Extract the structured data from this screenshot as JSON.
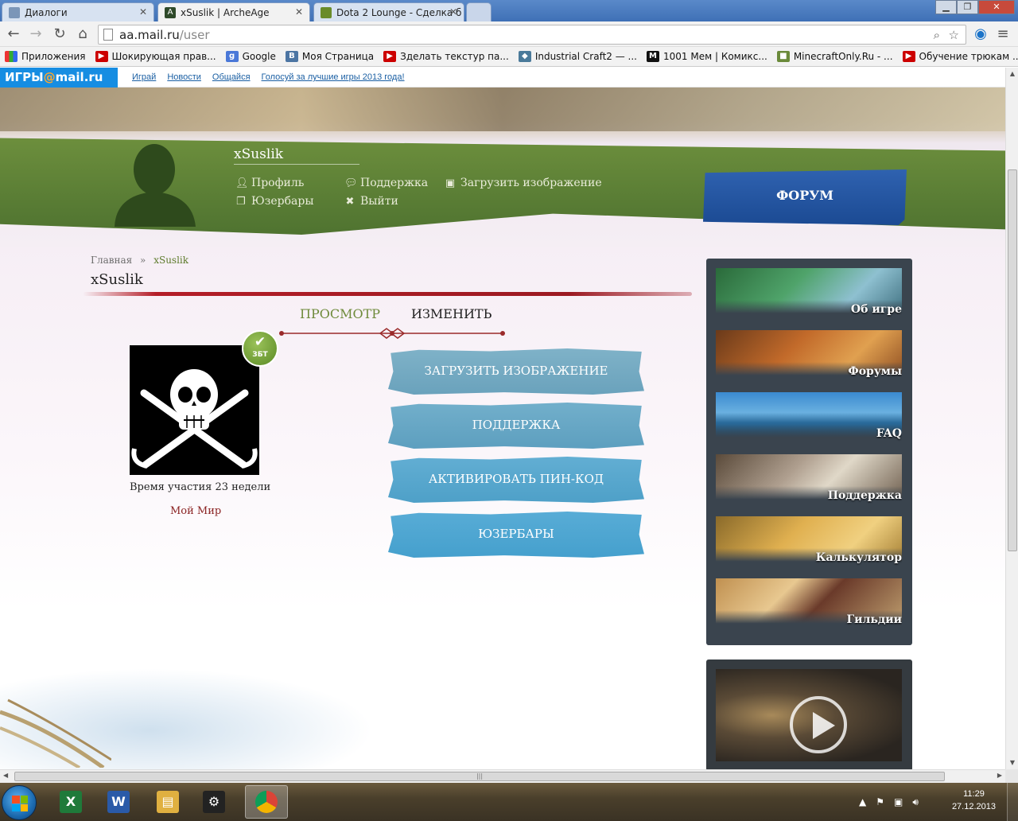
{
  "browser": {
    "tabs": [
      {
        "label": "Диалоги",
        "icon": "vk-dialogs-icon"
      },
      {
        "label": "xSuslik | ArcheAge",
        "icon": "archeage-icon",
        "active": true
      },
      {
        "label": "Dota 2 Lounge - Сделка б",
        "icon": "dota2lounge-icon"
      }
    ],
    "address": {
      "host": "aa.mail.ru",
      "path": "/user"
    },
    "bookmarks": [
      {
        "label": "Приложения",
        "icon": "apps-grid-icon"
      },
      {
        "label": "Шокирующая прав...",
        "icon": "youtube-icon"
      },
      {
        "label": "Google",
        "icon": "google-icon"
      },
      {
        "label": "Моя Страница",
        "icon": "vk-icon"
      },
      {
        "label": "Зделать текстур па...",
        "icon": "youtube-icon"
      },
      {
        "label": "Industrial Craft2 — ...",
        "icon": "ic2-icon"
      },
      {
        "label": "1001 Мем | Комикс...",
        "icon": "meme-icon"
      },
      {
        "label": "MinecraftOnly.Ru - ...",
        "icon": "minecraft-icon"
      },
      {
        "label": "Обучение трюкам ...",
        "icon": "youtube-icon"
      }
    ]
  },
  "mailbar": {
    "logo": {
      "part1": "ИГРЫ",
      "at": "@",
      "part2": "mail.ru"
    },
    "links": [
      "Играй",
      "Новости",
      "Общайся",
      "Голосуй за лучшие игры 2013 года!"
    ]
  },
  "header": {
    "username": "xSuslik",
    "links": {
      "profile": "Профиль",
      "userbars": "Юзербары",
      "support": "Поддержка",
      "logout": "Выйти",
      "upload": "Загрузить изображение"
    },
    "forum_button": "ФОРУМ"
  },
  "main": {
    "breadcrumb": {
      "home": "Главная",
      "separator": "»",
      "current": "xSuslik"
    },
    "title": "xSuslik",
    "tabs": {
      "view": "ПРОСМОТР",
      "edit": "ИЗМЕНИТЬ"
    },
    "badge": "ЗБТ",
    "participation": "Время участия  23 недели",
    "my_world": "Мой Мир",
    "actions": [
      "ЗАГРУЗИТЬ ИЗОБРАЖЕНИЕ",
      "ПОДДЕРЖКА",
      "АКТИВИРОВАТЬ ПИН-КОД",
      "ЮЗЕРБАРЫ"
    ]
  },
  "sidebar": {
    "items": [
      "Об игре",
      "Форумы",
      "FAQ",
      "Поддержка",
      "Калькулятор",
      "Гильдии"
    ]
  },
  "taskbar": {
    "apps": [
      "excel-icon",
      "word-icon",
      "file-explorer-icon",
      "steam-icon",
      "chrome-icon"
    ],
    "time": "11:29",
    "date": "27.12.2013"
  },
  "colors": {
    "header_green": "#5a7f34",
    "forum_blue": "#2557a3",
    "action_blue": "#5aa9cc",
    "title_rule_red": "#b41e28",
    "sidebar_dark": "#3a444e"
  }
}
